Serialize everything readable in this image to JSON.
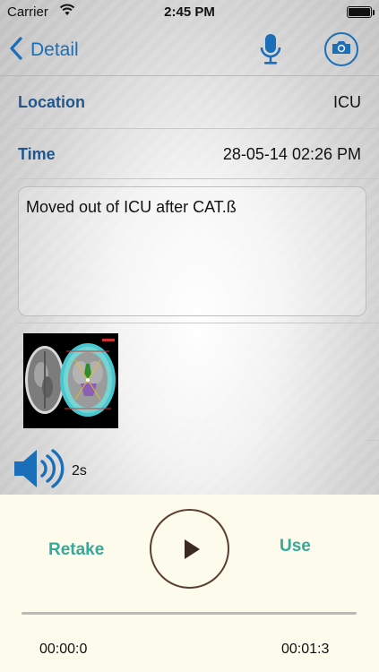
{
  "status_bar": {
    "carrier": "Carrier",
    "time": "2:45 PM",
    "battery_level": 1.0
  },
  "nav": {
    "back_label": "Detail",
    "icons": [
      "chevron-left-icon",
      "microphone-icon",
      "camera-icon"
    ]
  },
  "details": {
    "location_label": "Location",
    "location_value": "ICU",
    "time_label": "Time",
    "time_value": "28-05-14 02:26 PM"
  },
  "note_text": "Moved out of ICU after CAT.ß",
  "audio": {
    "duration": "2s",
    "icon": "speaker-icon"
  },
  "player": {
    "retake_label": "Retake",
    "use_label": "Use",
    "elapsed": "00:00:0",
    "total": "00:01:3",
    "progress": 0.0
  },
  "colors": {
    "nav_blue": "#1a6fb8",
    "label_blue": "#22578d",
    "action_teal": "#35aa9a",
    "play_brown": "#5b3f33",
    "panel_bg": "#fdfbeb"
  }
}
